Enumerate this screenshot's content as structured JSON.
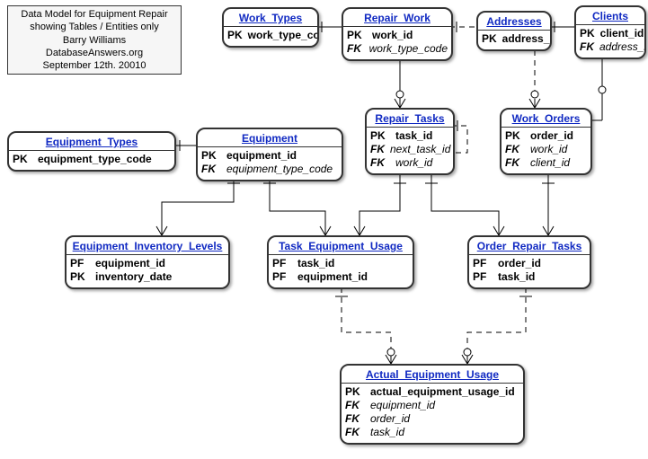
{
  "caption": {
    "l1": "Data Model for Equipment Repair",
    "l2": "showing Tables / Entities only",
    "l3": "Barry Williams",
    "l4": "DatabaseAnswers.org",
    "l5": "September 12th. 20010"
  },
  "entities": {
    "work_types": {
      "title": "Work_Types",
      "cols": [
        {
          "k": "PK",
          "n": "work_type_code",
          "cls": "pk"
        }
      ]
    },
    "repair_work": {
      "title": "Repair_Work",
      "cols": [
        {
          "k": "PK",
          "n": "work_id",
          "cls": "pk"
        },
        {
          "k": "FK",
          "n": "work_type_code",
          "cls": "fk"
        }
      ]
    },
    "addresses": {
      "title": "Addresses",
      "cols": [
        {
          "k": "PK",
          "n": "address_id",
          "cls": "pk"
        }
      ]
    },
    "clients": {
      "title": "Clients",
      "cols": [
        {
          "k": "PK",
          "n": "client_id",
          "cls": "pk"
        },
        {
          "k": "FK",
          "n": "address_id",
          "cls": "fk"
        }
      ]
    },
    "equipment_types": {
      "title": "Equipment_Types",
      "cols": [
        {
          "k": "PK",
          "n": "equipment_type_code",
          "cls": "pk"
        }
      ]
    },
    "equipment": {
      "title": "Equipment",
      "cols": [
        {
          "k": "PK",
          "n": "equipment_id",
          "cls": "pk"
        },
        {
          "k": "FK",
          "n": "equipment_type_code",
          "cls": "fk"
        }
      ]
    },
    "repair_tasks": {
      "title": "Repair_Tasks",
      "cols": [
        {
          "k": "PK",
          "n": "task_id",
          "cls": "pk"
        },
        {
          "k": "FK",
          "n": "next_task_id",
          "cls": "fk"
        },
        {
          "k": "FK",
          "n": "work_id",
          "cls": "fk"
        }
      ]
    },
    "work_orders": {
      "title": "Work_Orders",
      "cols": [
        {
          "k": "PK",
          "n": "order_id",
          "cls": "pk"
        },
        {
          "k": "FK",
          "n": "work_id",
          "cls": "fk"
        },
        {
          "k": "FK",
          "n": "client_id",
          "cls": "fk"
        }
      ]
    },
    "equipment_inventory_levels": {
      "title": "Equipment_Inventory_Levels",
      "cols": [
        {
          "k": "PF",
          "n": "equipment_id",
          "cls": "pk"
        },
        {
          "k": "PK",
          "n": "inventory_date",
          "cls": "pk"
        }
      ]
    },
    "task_equipment_usage": {
      "title": "Task_Equipment_Usage",
      "cols": [
        {
          "k": "PF",
          "n": "task_id",
          "cls": "pk"
        },
        {
          "k": "PF",
          "n": "equipment_id",
          "cls": "pk"
        }
      ]
    },
    "order_repair_tasks": {
      "title": "Order_Repair_Tasks",
      "cols": [
        {
          "k": "PF",
          "n": "order_id",
          "cls": "pk"
        },
        {
          "k": "PF",
          "n": "task_id",
          "cls": "pk"
        }
      ]
    },
    "actual_equipment_usage": {
      "title": "Actual_Equipment_Usage",
      "cols": [
        {
          "k": "PK",
          "n": "actual_equipment_usage_id",
          "cls": "pk"
        },
        {
          "k": "FK",
          "n": "equipment_id",
          "cls": "fk"
        },
        {
          "k": "FK",
          "n": "order_id",
          "cls": "fk"
        },
        {
          "k": "FK",
          "n": "task_id",
          "cls": "fk"
        }
      ]
    }
  }
}
